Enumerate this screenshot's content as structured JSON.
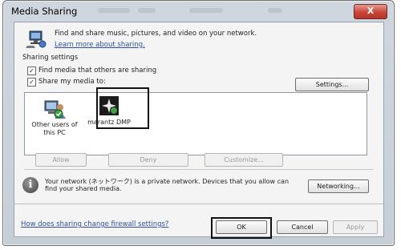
{
  "window": {
    "title": "Media Sharing",
    "close_glyph": "X"
  },
  "intro": {
    "text": "Find and share music, pictures, and video on your network.",
    "learn_more": "Learn more about sharing."
  },
  "sharing_settings": {
    "label": "Sharing settings",
    "find_media": "Find media that others are sharing",
    "share_media": "Share my media to:",
    "settings_button": "Settings..."
  },
  "devices": [
    {
      "label_line1": "Other users of",
      "label_line2": "this PC",
      "icon": "users-pc-icon"
    },
    {
      "label_line1": "marantz DMP",
      "label_line2": "",
      "icon": "media-device-icon"
    }
  ],
  "device_actions": {
    "allow": "Allow",
    "deny": "Deny",
    "customize": "Customize..."
  },
  "network_info": {
    "line1": "Your network (ネットワーク) is a private network. Devices that you allow can",
    "line2": "find your shared media.",
    "networking_button": "Networking..."
  },
  "footer": {
    "firewall_link": "How does sharing change firewall settings?",
    "ok": "OK",
    "cancel": "Cancel",
    "apply": "Apply"
  }
}
